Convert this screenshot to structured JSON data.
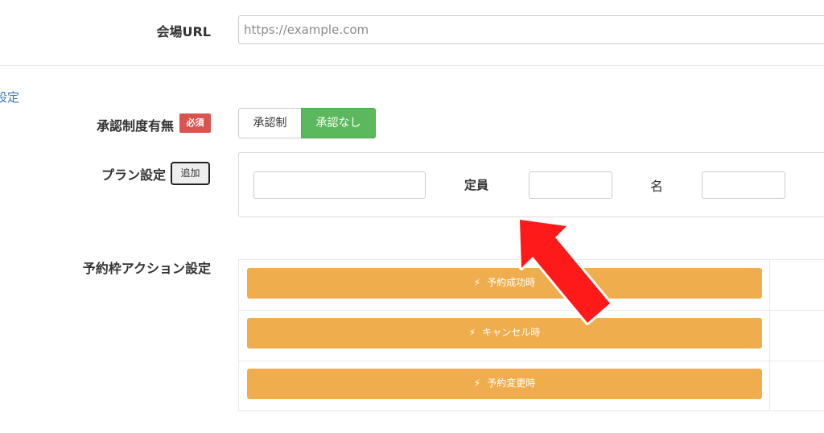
{
  "venue": {
    "label": "会場URL",
    "placeholder": "https://example.com"
  },
  "section": {
    "partial_title": "設定"
  },
  "approval": {
    "label": "承認制度有無",
    "required_badge": "必須",
    "option_approval": "承認制",
    "option_no_approval": "承認なし",
    "selected": "承認なし"
  },
  "plan": {
    "label": "プラン設定",
    "add_button": "追加",
    "capacity_label": "定員",
    "unit_label": "名"
  },
  "actions": {
    "label": "予約枠アクション設定",
    "buttons": [
      {
        "label": "予約成功時"
      },
      {
        "label": "キャンセル時"
      },
      {
        "label": "予約変更時"
      }
    ]
  },
  "colors": {
    "required": "#d9534f",
    "selected_toggle": "#5cb85c",
    "action_button": "#f0ad4e",
    "arrow": "#ff0000"
  },
  "icons": {
    "action_icon": "lightning-bolt-icon",
    "annotation": "red-arrow-icon"
  }
}
